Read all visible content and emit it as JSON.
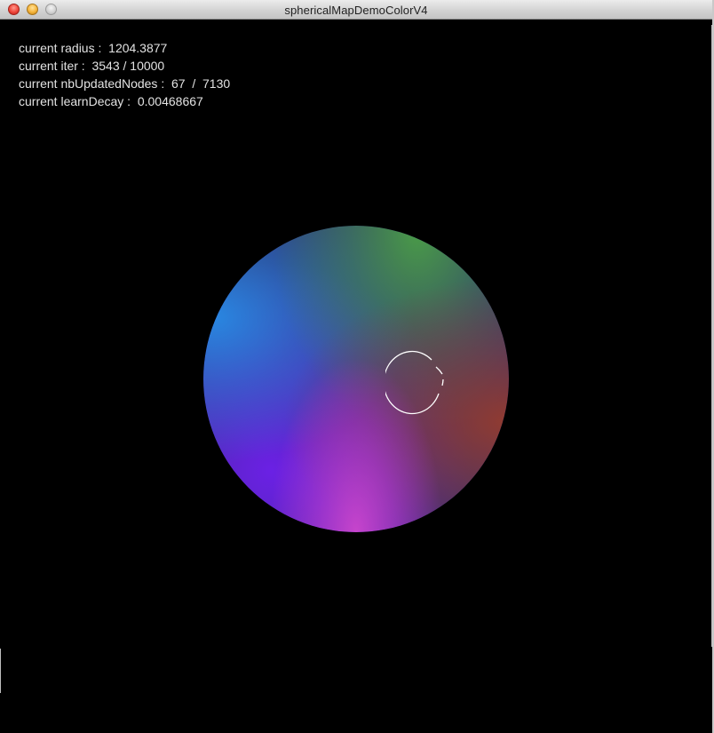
{
  "window": {
    "title": "sphericalMapDemoColorV4"
  },
  "hud": {
    "lines": [
      "current radius :  1204.3877",
      "current iter :  3543 / 10000",
      "current nbUpdatedNodes :  67  /  7130",
      "current learnDecay :  0.00468667"
    ]
  },
  "sphere": {
    "colors": {
      "center": "#2f2d6e",
      "top_right": "#4ba046",
      "left": "#288ce6",
      "bottom_left": "#6e20eb",
      "right": "#963c2d",
      "bottom": "#cd46cd"
    }
  },
  "icons": {
    "close": "close-icon",
    "minimize": "minimize-icon",
    "maximize": "zoom-icon",
    "cursor": "brush-ring-icon"
  }
}
